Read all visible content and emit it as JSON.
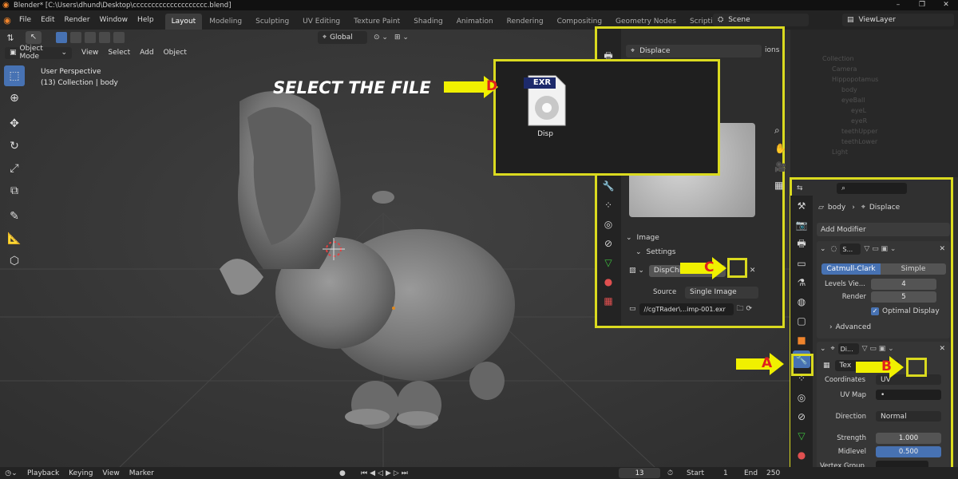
{
  "window": {
    "title": "Blender* [C:\\Users\\dhund\\Desktop\\cccccccccccccccccccc.blend]",
    "min": "–",
    "max": "❐",
    "close": "✕"
  },
  "menu": [
    "File",
    "Edit",
    "Render",
    "Window",
    "Help"
  ],
  "workspaces": [
    "Layout",
    "Modeling",
    "Sculpting",
    "UV Editing",
    "Texture Paint",
    "Shading",
    "Animation",
    "Rendering",
    "Compositing",
    "Geometry Nodes",
    "Scripting"
  ],
  "workspace_add": "+",
  "scene": "Scene",
  "view_layer": "ViewLayer",
  "viewport": {
    "mode": "Object Mode",
    "header_menu": [
      "View",
      "Select",
      "Add",
      "Object"
    ],
    "orientation": "Global",
    "info_line1": "User Perspective",
    "info_line2": "(13) Collection | body"
  },
  "annotation": {
    "select_file": "SELECT THE FILE",
    "A": "A",
    "B": "B",
    "C": "C",
    "D": "D"
  },
  "file_popup": {
    "badge": "EXR",
    "name": "Disp"
  },
  "texture_panel": {
    "name": "Displace",
    "image_section": "Image",
    "settings_section": "Settings",
    "image_name": "DispChin",
    "source_label": "Source",
    "source_value": "Single Image",
    "filepath": "//cgTRader\\...imp-001.exr",
    "options_trunc": "ions"
  },
  "properties": {
    "breadcrumb_obj": "body",
    "breadcrumb_mod": "Displace",
    "add_modifier": "Add Modifier",
    "subsurf": {
      "name": "S...",
      "catmull": "Catmull-Clark",
      "simple": "Simple",
      "levels_label": "Levels Vie...",
      "levels": "4",
      "render_label": "Render",
      "render": "5",
      "optimal": "Optimal Display",
      "advanced": "Advanced"
    },
    "displace": {
      "name": "Di...",
      "texture": "Tex",
      "coordinates_label": "Coordinates",
      "coordinates": "UV",
      "uvmap_label": "UV Map",
      "uvmap": "•",
      "direction_label": "Direction",
      "direction": "Normal",
      "strength_label": "Strength",
      "strength": "1.000",
      "midlevel_label": "Midlevel",
      "midlevel": "0.500",
      "vgroup_label": "Vertex Group"
    }
  },
  "outliner": [
    "Collection",
    "Camera",
    "Hippopotamus",
    "body",
    "eyeBall",
    "eyeL",
    "eyeR",
    "teethUpper",
    "teethLower",
    "Light"
  ],
  "timeline": {
    "menu": [
      "Playback",
      "Keying",
      "View",
      "Marker"
    ],
    "frame": "13",
    "start_label": "Start",
    "start": "1",
    "end_label": "End",
    "end": "250"
  },
  "colors": {
    "accent": "#4772b3",
    "highlight": "#dada1f",
    "arrow": "#f0f000",
    "label": "#e0201e"
  }
}
